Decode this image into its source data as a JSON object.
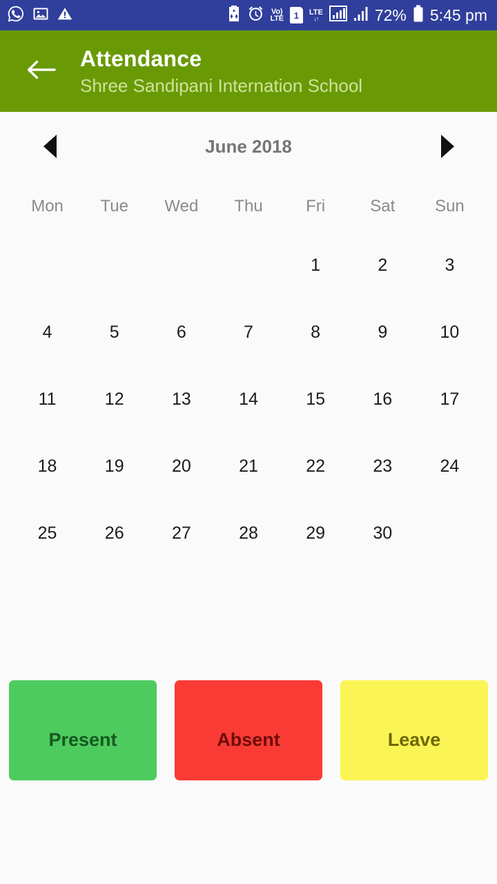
{
  "status_bar": {
    "background": "#303e9c",
    "left_icons": [
      "whatsapp-icon",
      "image-icon",
      "warning-icon"
    ],
    "right_icons": [
      "battery-saver-icon",
      "alarm-icon",
      "volte-icon",
      "sim1-icon",
      "lte-data-icon",
      "signal-bars-icon",
      "signal-bars-2-icon",
      "battery-icon"
    ],
    "volte_top": "Vo)",
    "volte_bottom": "LTE",
    "sim_label": "1",
    "lte_label": "LTE",
    "lte_arrows": "↓↑",
    "battery_percent": "72%",
    "time": "5:45 pm"
  },
  "app_bar": {
    "background": "#699a06",
    "back_icon": "arrow-left-icon",
    "title": "Attendance",
    "subtitle": "Shree Sandipani Internation School"
  },
  "month_nav": {
    "prev_icon": "triangle-left-icon",
    "next_icon": "triangle-right-icon",
    "label": "June 2018"
  },
  "calendar": {
    "day_names": [
      "Mon",
      "Tue",
      "Wed",
      "Thu",
      "Fri",
      "Sat",
      "Sun"
    ],
    "weeks": [
      [
        "",
        "",
        "",
        "",
        "1",
        "2",
        "3"
      ],
      [
        "4",
        "5",
        "6",
        "7",
        "8",
        "9",
        "10"
      ],
      [
        "11",
        "12",
        "13",
        "14",
        "15",
        "16",
        "17"
      ],
      [
        "18",
        "19",
        "20",
        "21",
        "22",
        "23",
        "24"
      ],
      [
        "25",
        "26",
        "27",
        "28",
        "29",
        "30",
        ""
      ]
    ]
  },
  "legend": {
    "items": [
      {
        "label": "Present",
        "background": "#4ecb5e",
        "text_color": "#14591f"
      },
      {
        "label": "Absent",
        "background": "#fa3b35",
        "text_color": "#6d0d09"
      },
      {
        "label": "Leave",
        "background": "#fbf455",
        "text_color": "#6e6705"
      }
    ]
  }
}
